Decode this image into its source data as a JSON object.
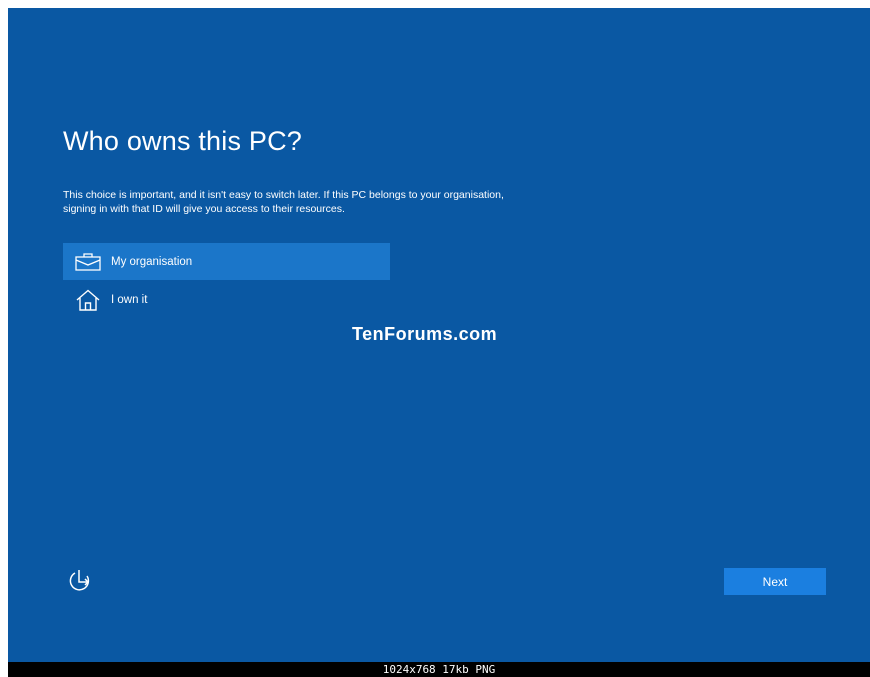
{
  "setup": {
    "title": "Who owns this PC?",
    "description_line1": "This choice is important, and it isn't easy to switch later. If this PC belongs to your organisation,",
    "description_line2": "signing in with that ID will give you access to their resources.",
    "options": [
      {
        "label": "My organisation",
        "icon": "briefcase-icon",
        "selected": true
      },
      {
        "label": "I own it",
        "icon": "house-icon",
        "selected": false
      }
    ],
    "next_label": "Next",
    "accessibility_icon": "ease-of-access-icon"
  },
  "watermark": "TenForums.com",
  "footer": {
    "caption": "1024x768 17kb PNG"
  },
  "colors": {
    "background": "#0a58a3",
    "selected_option": "#1b76c9",
    "button": "#1b7fe0",
    "text": "#ffffff"
  }
}
